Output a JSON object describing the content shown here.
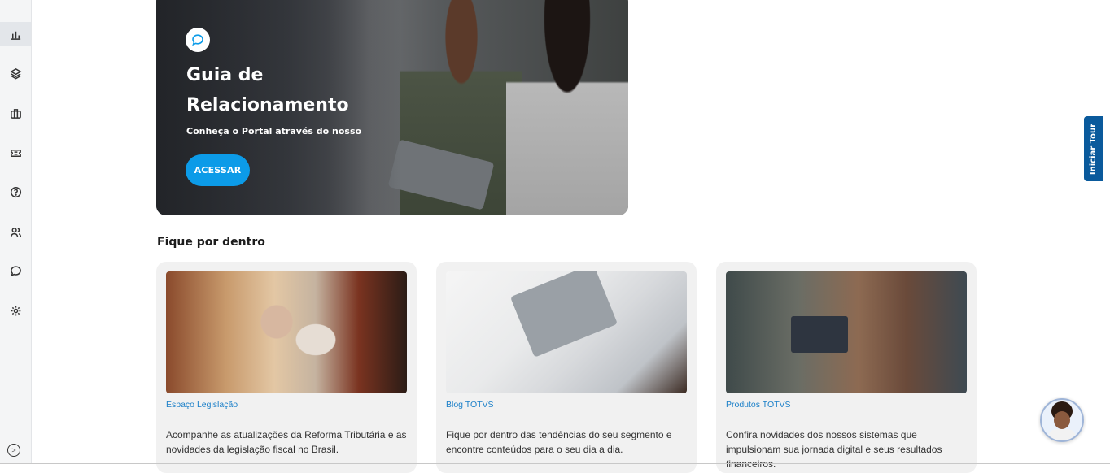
{
  "sidebar": {
    "items": [
      {
        "icon": "dashboard-chart-icon",
        "name": "Dashboard"
      },
      {
        "icon": "layers-icon",
        "name": "Layers"
      },
      {
        "icon": "briefcase-icon",
        "name": "Briefcase"
      },
      {
        "icon": "ticket-icon",
        "name": "Ticket"
      },
      {
        "icon": "help-circle-icon",
        "name": "Help"
      },
      {
        "icon": "users-icon",
        "name": "Users"
      },
      {
        "icon": "chat-bubble-icon",
        "name": "Chat"
      },
      {
        "icon": "settings-gear-icon",
        "name": "Settings"
      }
    ],
    "collapse_glyph": ">"
  },
  "hero": {
    "title": "Guia de Relacionamento",
    "subtitle": "Conheça o Portal através do nosso",
    "button_label": "ACESSAR",
    "accent_color": "#0c9be8"
  },
  "section": {
    "title": "Fique por dentro"
  },
  "cards": [
    {
      "tag": "Espaço Legislação",
      "description": "Acompanhe as atualizações da Reforma Tributária e as novidades da legislação fiscal no Brasil."
    },
    {
      "tag": "Blog TOTVS",
      "description": "Fique por dentro das tendências do seu segmento e encontre conteúdos para o seu dia a dia."
    },
    {
      "tag": "Produtos TOTVS",
      "description": "Confira novidades dos nossos sistemas que impulsionam sua jornada digital e seus resultados financeiros."
    }
  ],
  "tour_button": {
    "label": "Iniciar Tour",
    "color": "#0a5a9c"
  }
}
